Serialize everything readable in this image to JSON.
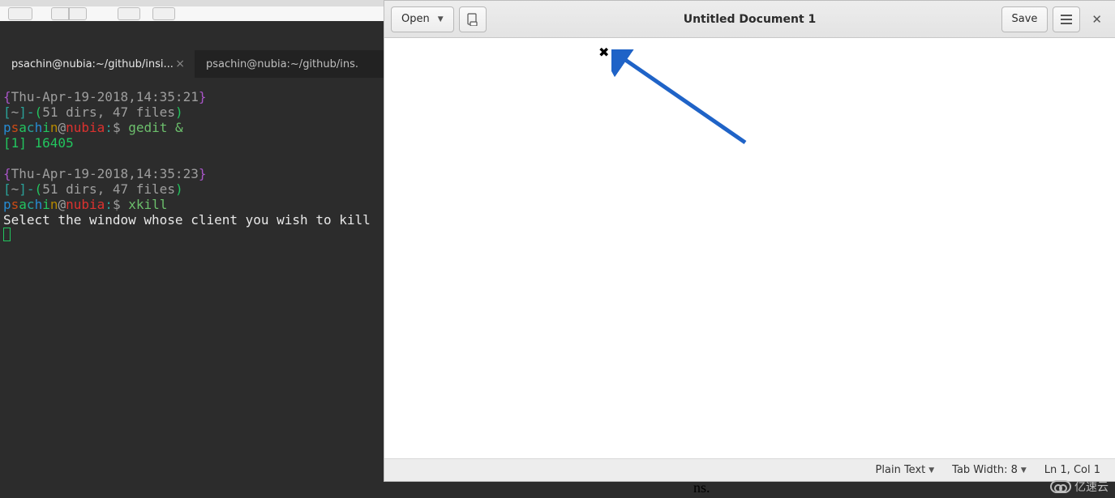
{
  "terminal": {
    "title_partial": "psachin@nubia",
    "tabs": [
      {
        "label": "psachin@nubia:~/github/insi...",
        "active": true
      },
      {
        "label": "psachin@nubia:~/github/ins.",
        "active": false
      }
    ],
    "prompt_blocks": [
      {
        "timestamp": "Thu-Apr-19-2018,14:35:21",
        "cwd": "~",
        "stat": "51 dirs, 47 files",
        "user": "psachin",
        "host": "nubia",
        "command": "gedit &",
        "output": "[1] 16405"
      },
      {
        "timestamp": "Thu-Apr-19-2018,14:35:23",
        "cwd": "~",
        "stat": "51 dirs, 47 files",
        "user": "psachin",
        "host": "nubia",
        "command": "xkill",
        "output": "Select the window whose client you wish to kill"
      }
    ]
  },
  "gedit": {
    "open_label": "Open",
    "save_label": "Save",
    "title": "Untitled Document 1",
    "status": {
      "syntax": "Plain Text",
      "tab_width_label": "Tab Width: 8",
      "cursor": "Ln 1, Col 1"
    }
  },
  "fragment_text": "ns.",
  "watermark_text": "亿速云"
}
